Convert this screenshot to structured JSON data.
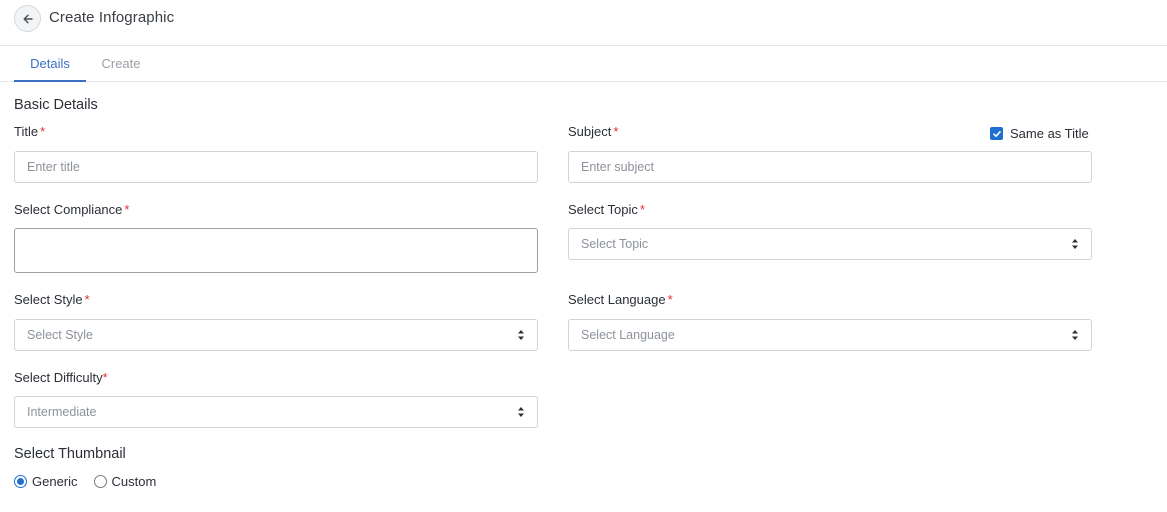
{
  "header": {
    "title": "Create Infographic",
    "back_icon": "arrow-left-icon"
  },
  "tabs": [
    {
      "label": "Details",
      "active": true
    },
    {
      "label": "Create",
      "active": false
    }
  ],
  "basic_details": {
    "section_title": "Basic Details",
    "title_field": {
      "label": "Title",
      "required_mark": "*",
      "placeholder": "Enter title",
      "value": ""
    },
    "subject_field": {
      "label": "Subject",
      "required_mark": "*",
      "placeholder": "Enter subject",
      "value": ""
    },
    "same_as_title": {
      "label": "Same as Title",
      "checked": true
    },
    "compliance_field": {
      "label": "Select Compliance",
      "required_mark": "*",
      "value": ""
    },
    "topic_field": {
      "label": "Select Topic",
      "required_mark": "*",
      "selected": "Select Topic"
    },
    "style_field": {
      "label": "Select Style",
      "required_mark": "*",
      "selected": "Select Style"
    },
    "language_field": {
      "label": "Select Language",
      "required_mark": "*",
      "selected": "Select Language"
    },
    "difficulty_field": {
      "label": "Select Difficulty",
      "required_mark": "*",
      "selected": "Intermediate"
    }
  },
  "thumbnail": {
    "section_title": "Select Thumbnail",
    "options": [
      {
        "label": "Generic",
        "selected": true
      },
      {
        "label": "Custom",
        "selected": false
      }
    ]
  },
  "colors": {
    "accent": "#3b6fc4",
    "required": "#e0303a",
    "checkbox": "#1f6fd1"
  }
}
